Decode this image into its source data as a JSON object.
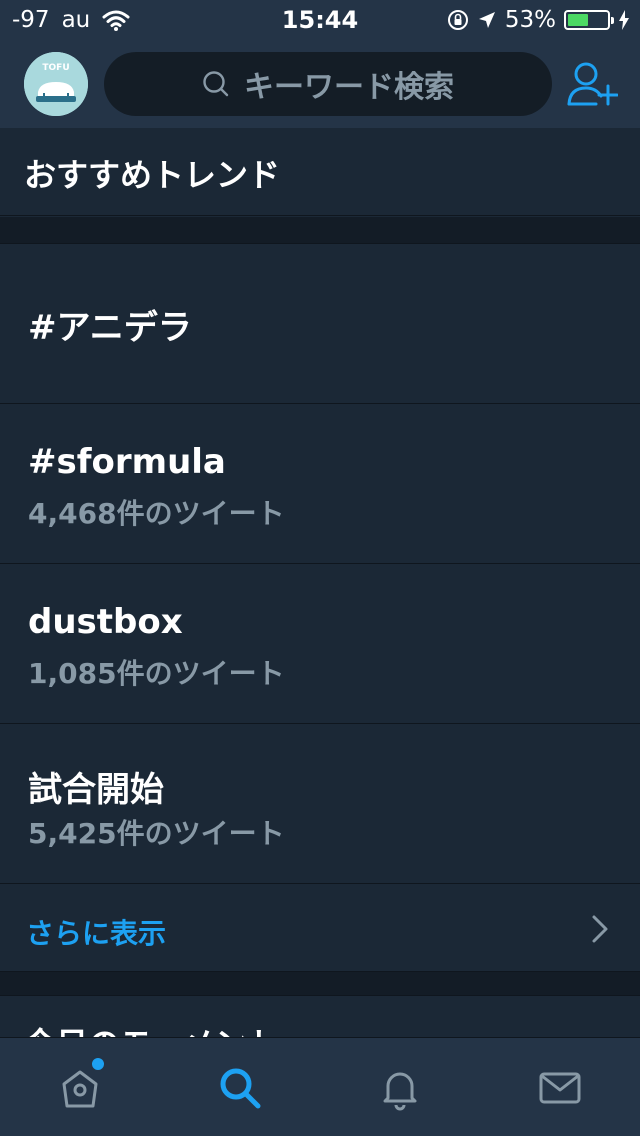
{
  "status_bar": {
    "signal": "-97",
    "carrier": "au",
    "time": "15:44",
    "battery_percent": "53%",
    "battery_level": 0.53
  },
  "header": {
    "avatar_text": "TOFU",
    "search_placeholder": "キーワード検索"
  },
  "trends": {
    "title": "おすすめトレンド",
    "items": [
      {
        "name": "#アニデラ",
        "count": ""
      },
      {
        "name": "#sformula",
        "count": "4,468件のツイート"
      },
      {
        "name": "dustbox",
        "count": "1,085件のツイート"
      },
      {
        "name": "試合開始",
        "count": "5,425件のツイート"
      }
    ],
    "show_more": "さらに表示"
  },
  "next_section": {
    "title": "今日のモーメント"
  },
  "colors": {
    "accent": "#1da1f2",
    "background": "#1b2836",
    "bar": "#243447",
    "secondary_text": "#8899a6"
  },
  "tab_bar": {
    "tabs": [
      "home-icon",
      "search-icon",
      "bell-icon",
      "mail-icon"
    ],
    "active": "search-icon"
  }
}
